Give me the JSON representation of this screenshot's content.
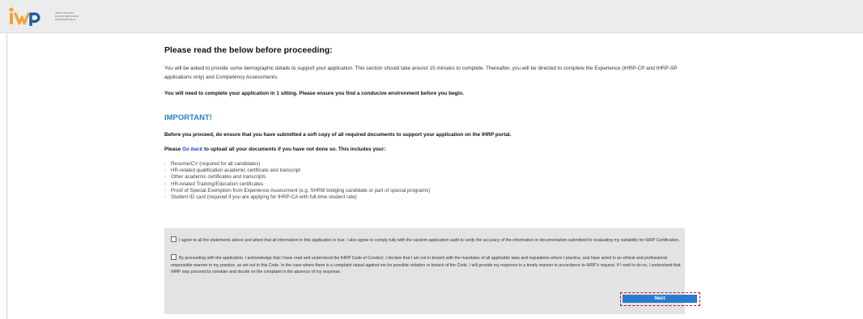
{
  "header": {
    "logo_letters": "ihrp",
    "logo_text_lines": [
      "INSTITUTE FOR",
      "HUMAN RESOURCE",
      "PROFESSIONALS"
    ]
  },
  "content": {
    "title": "Please read the below before proceeding:",
    "intro": "You will be asked to provide some demographic details to support your application. This section should take around 15 minutes to complete. Thereafter, you will be directed to complete the Experience (IHRP-CP and IHRP-SP applications only) and Competency Assessments.",
    "sitting_notice": "You will need to complete your application in 1 sitting. Please ensure you find a conducive environment before you begin.",
    "important_heading": "IMPORTANT!",
    "before_proceed": "Before you proceed, do ensure that you have submitted a soft copy of all required documents to support your application on the IHRP portal.",
    "please_prefix": "Please",
    "go_back_link": "Go back",
    "please_suffix": "to upload all your documents if you have not done so. This includes your:",
    "documents": [
      "Resume/CV (required for all candidates)",
      "HR-related qualification academic certificate and transcript",
      "Other academic certificates and transcripts",
      "HR-related Training/Education certificates",
      "Proof of Special Exemption from Experience Assessment (e.g. SHRM bridging candidate or part of special programs)",
      "Student ID card (required if you are applying for IHRP-CA with full-time student rate)"
    ]
  },
  "agreements": {
    "agree_statement": "I agree to all the statements above and attest that all information in this application is true. I also agree to comply fully with the random application audit to verify the accuracy of the information or documentation submitted for evaluating my suitability for IHRP Certification.",
    "code_statement": "By proceeding with the application, I acknowledge that I have read and understood the IHRP Code of Conduct. I declare that I am not in breach with the mandates of all applicable laws and regulations where I practice, and have acted in an ethical and professional responsible manner in my practice, as set out in this Code. In the case where there is a complaint raised against me for possible violation or breach of the Code, I will provide my response in a timely manner in accordance to IHRP's request. If I omit to do so, I understand that IHRP may proceed to consider and decide on the complaint in the absence of my response.",
    "agree_checked": false,
    "code_checked": false
  },
  "actions": {
    "next_label": "Next"
  },
  "colors": {
    "accent_blue": "#2a7ccf",
    "important_blue": "#2d7fc1",
    "link_blue": "#1f44c9",
    "highlight_red": "#b3151f",
    "agree_panel_bg": "#e3e3e3",
    "logo_orange": "#f0a23a",
    "logo_blue": "#1d5da8"
  }
}
